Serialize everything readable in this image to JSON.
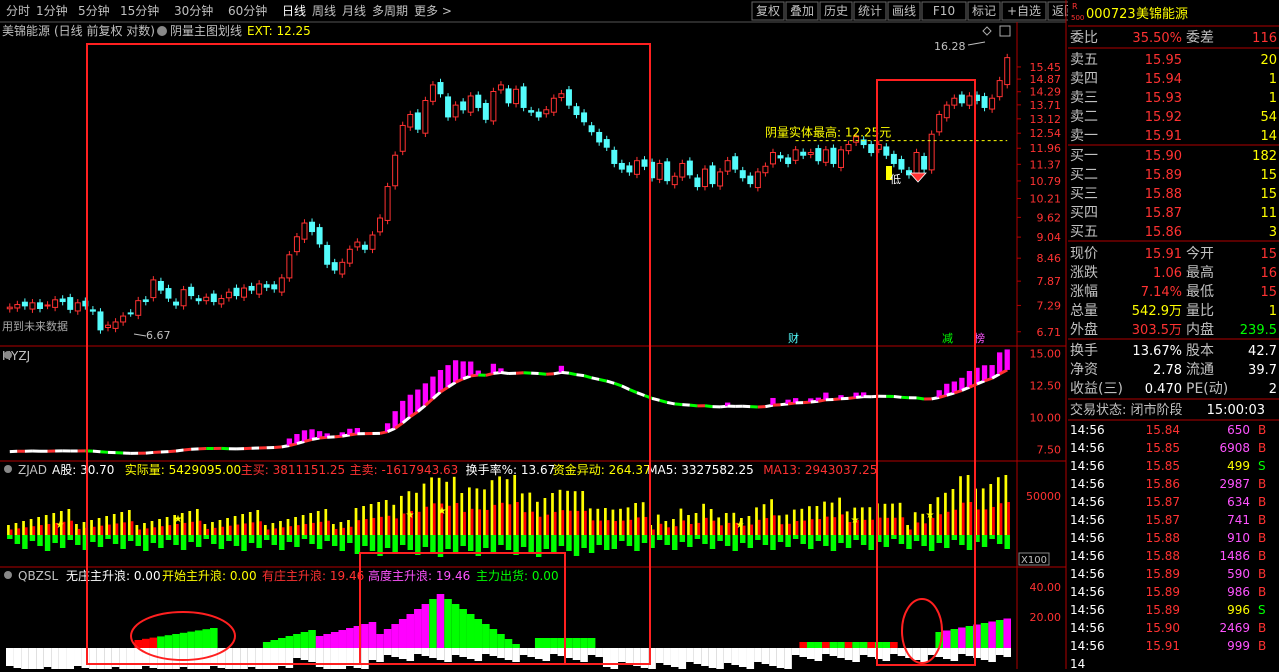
{
  "toolbar": {
    "periods": [
      "分时",
      "1分钟",
      "5分钟",
      "15分钟",
      "30分钟",
      "60分钟",
      "日线",
      "周线",
      "月线",
      "多周期",
      "更多 >"
    ],
    "active_period": "日线",
    "actions": [
      "复权",
      "叠加",
      "历史",
      "统计",
      "画线",
      "F10",
      "标记",
      "+自选",
      "返回"
    ]
  },
  "chart_header": {
    "stock": "美锦能源",
    "mode": "(日线 前复权 对数)",
    "indicator": "阴量主图划线",
    "ext": "EXT: 12.25"
  },
  "price_axis": [
    "15.45",
    "14.87",
    "14.29",
    "13.71",
    "13.12",
    "12.54",
    "11.96",
    "11.37",
    "10.79",
    "10.21",
    "9.62",
    "9.04",
    "8.46",
    "7.87",
    "7.29",
    "6.71"
  ],
  "annotations": {
    "high_label": "16.28",
    "low_label": "6.67",
    "yinliang_label": "阴量实体最高: 12.25元",
    "future_label": "用到未来数据",
    "di": "低",
    "cai": "财",
    "jian": "减",
    "bang": "榜"
  },
  "chart_data": [
    {
      "type": "candlestick",
      "ylim": [
        6.6,
        16.4
      ],
      "scale": "log",
      "close": [
        7.25,
        7.31,
        7.28,
        7.35,
        7.22,
        7.3,
        7.42,
        7.38,
        7.2,
        7.35,
        7.28,
        7.16,
        6.75,
        6.85,
        6.92,
        7.05,
        7.12,
        7.4,
        7.38,
        7.9,
        7.65,
        7.46,
        7.3,
        7.66,
        7.52,
        7.4,
        7.48,
        7.38,
        7.45,
        7.6,
        7.52,
        7.7,
        7.65,
        7.8,
        7.72,
        7.68,
        7.95,
        8.55,
        9.05,
        9.45,
        9.2,
        8.85,
        8.3,
        8.15,
        8.35,
        8.7,
        8.9,
        8.7,
        9.1,
        9.6,
        10.6,
        11.7,
        12.85,
        13.3,
        12.7,
        13.9,
        14.6,
        14.2,
        13.2,
        13.7,
        13.5,
        14.1,
        13.6,
        13.1,
        14.3,
        14.6,
        13.8,
        14.4,
        13.6,
        13.4,
        13.2,
        13.5,
        14.0,
        14.2,
        13.7,
        13.3,
        13.0,
        12.6,
        12.2,
        12.0,
        11.4,
        11.2,
        11.1,
        11.5,
        11.3,
        10.9,
        11.4,
        10.8,
        10.95,
        11.4,
        11.0,
        10.6,
        11.2,
        10.7,
        11.1,
        11.5,
        11.2,
        10.9,
        10.7,
        11.1,
        11.3,
        11.8,
        11.6,
        11.4,
        11.9,
        11.7,
        11.8,
        11.5,
        11.9,
        11.4,
        11.9,
        12.1,
        12.4,
        12.1,
        11.8,
        12.1,
        11.7,
        11.4,
        11.2,
        11.0,
        11.8,
        11.2,
        12.5,
        13.3,
        13.7,
        14.0,
        13.8,
        14.1,
        13.9,
        13.6,
        14.0,
        14.8,
        15.91
      ],
      "colors": {
        "up": "#ff3232",
        "down": "#54fcfc",
        "ma": "#ffff00"
      }
    },
    {
      "type": "bar",
      "title": "HYZJ",
      "ylim": [
        7.0,
        15.2
      ],
      "ticks": [
        "15.00",
        "12.50",
        "10.00",
        "7.50"
      ]
    },
    {
      "type": "bar",
      "title": "ZJAD",
      "ticks": [
        "50000"
      ],
      "scale_label": "X100",
      "stats": [
        {
          "label": "A股: 30.70",
          "color": "#ffffff"
        },
        {
          "label": "实际量: 5429095.00",
          "color": "#ffff00"
        },
        {
          "label": "主买: 3811151.25",
          "color": "#ff3232"
        },
        {
          "label": "主卖: -1617943.63",
          "color": "#ff3232"
        },
        {
          "label": "换手率%: 13.67",
          "color": "#ffffff"
        },
        {
          "label": "资金异动: 264.37",
          "color": "#ffff00"
        },
        {
          "label": "MA5: 3327582.25",
          "color": "#ffffff"
        },
        {
          "label": "MA13: 2943037.25",
          "color": "#ff3232"
        }
      ]
    },
    {
      "type": "area",
      "title": "QBZSL",
      "ticks": [
        "40.00",
        "20.00"
      ],
      "stats": [
        {
          "label": "无庄主升浪: 0.00",
          "color": "#ffffff"
        },
        {
          "label": "开始主升浪: 0.00",
          "color": "#ffff00"
        },
        {
          "label": "有庄主升浪: 19.46",
          "color": "#ff3232"
        },
        {
          "label": "高度主升浪: 19.46",
          "color": "#ff54ff"
        },
        {
          "label": "主力出货: 0.00",
          "color": "#00ff00"
        }
      ]
    }
  ],
  "quote": {
    "code": "000723",
    "name": "美锦能源",
    "badge_top": "R",
    "badge_bottom": "500",
    "weibi_label": "委比",
    "weibi": "35.50%",
    "weicha_label": "委差",
    "weicha": "116",
    "sells": [
      {
        "label": "卖五",
        "price": "15.95",
        "vol": "20"
      },
      {
        "label": "卖四",
        "price": "15.94",
        "vol": "1"
      },
      {
        "label": "卖三",
        "price": "15.93",
        "vol": "1"
      },
      {
        "label": "卖二",
        "price": "15.92",
        "vol": "54"
      },
      {
        "label": "卖一",
        "price": "15.91",
        "vol": "14"
      }
    ],
    "buys": [
      {
        "label": "买一",
        "price": "15.90",
        "vol": "182"
      },
      {
        "label": "买二",
        "price": "15.89",
        "vol": "15"
      },
      {
        "label": "买三",
        "price": "15.88",
        "vol": "15"
      },
      {
        "label": "买四",
        "price": "15.87",
        "vol": "11"
      },
      {
        "label": "买五",
        "price": "15.86",
        "vol": "3"
      }
    ],
    "stats": [
      [
        {
          "l": "现价",
          "v": "15.91",
          "c": "#ff3232"
        },
        {
          "l": "今开",
          "v": "15",
          "c": "#ff3232"
        }
      ],
      [
        {
          "l": "涨跌",
          "v": "1.06",
          "c": "#ff3232"
        },
        {
          "l": "最高",
          "v": "16",
          "c": "#ff3232"
        }
      ],
      [
        {
          "l": "涨幅",
          "v": "7.14%",
          "c": "#ff3232"
        },
        {
          "l": "最低",
          "v": "15",
          "c": "#ff3232"
        }
      ],
      [
        {
          "l": "总量",
          "v": "542.9万",
          "c": "#ffff00"
        },
        {
          "l": "量比",
          "v": "1",
          "c": "#ffff00"
        }
      ],
      [
        {
          "l": "外盘",
          "v": "303.5万",
          "c": "#ff3232"
        },
        {
          "l": "内盘",
          "v": "239.5",
          "c": "#00ff00"
        }
      ]
    ],
    "stats2": [
      [
        {
          "l": "换手",
          "v": "13.67%",
          "c": "#ffffff"
        },
        {
          "l": "股本",
          "v": "42.7",
          "c": "#ffffff"
        }
      ],
      [
        {
          "l": "净资",
          "v": "2.78",
          "c": "#ffffff"
        },
        {
          "l": "流通",
          "v": "39.7",
          "c": "#ffffff"
        }
      ],
      [
        {
          "l": "收益(三)",
          "v": "0.470",
          "c": "#ffffff"
        },
        {
          "l": "PE(动)",
          "v": "2",
          "c": "#ffffff"
        }
      ]
    ],
    "status_label": "交易状态: 闭市阶段",
    "status_time": "15:00:03",
    "ticks": [
      {
        "t": "14:56",
        "p": "15.84",
        "v": "650",
        "s": "B"
      },
      {
        "t": "14:56",
        "p": "15.85",
        "v": "6908",
        "s": "B"
      },
      {
        "t": "14:56",
        "p": "15.85",
        "v": "499",
        "s": "S"
      },
      {
        "t": "14:56",
        "p": "15.86",
        "v": "2987",
        "s": "B"
      },
      {
        "t": "14:56",
        "p": "15.87",
        "v": "634",
        "s": "B"
      },
      {
        "t": "14:56",
        "p": "15.87",
        "v": "741",
        "s": "B"
      },
      {
        "t": "14:56",
        "p": "15.88",
        "v": "910",
        "s": "B"
      },
      {
        "t": "14:56",
        "p": "15.88",
        "v": "1486",
        "s": "B"
      },
      {
        "t": "14:56",
        "p": "15.89",
        "v": "590",
        "s": "B"
      },
      {
        "t": "14:56",
        "p": "15.89",
        "v": "986",
        "s": "B"
      },
      {
        "t": "14:56",
        "p": "15.89",
        "v": "996",
        "s": "S"
      },
      {
        "t": "14:56",
        "p": "15.90",
        "v": "2469",
        "s": "B"
      },
      {
        "t": "14:56",
        "p": "15.91",
        "v": "999",
        "s": "B"
      }
    ],
    "tick_last_time": "14"
  },
  "colors": {
    "accent": "#ff3232",
    "up": "#ff3232",
    "down": "#54fcfc",
    "highlight_box": "#ff2020"
  }
}
